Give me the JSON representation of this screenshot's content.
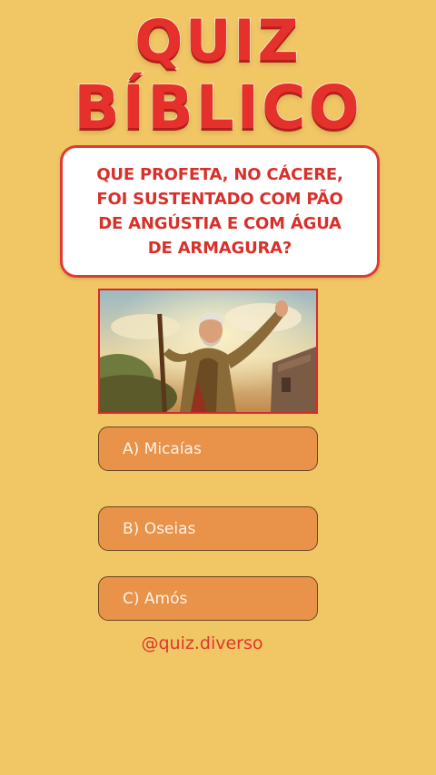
{
  "theme": {
    "background": "#f1c765",
    "accent": "#e5302b",
    "option_fill": "#e9924a"
  },
  "title": {
    "line1": "QUIZ",
    "line2": "BÍBLICO"
  },
  "question": {
    "line1": "QUE PROFETA, NO CÁCERE,",
    "line2": "FOI SUSTENTADO COM PÃO",
    "line3": "DE ANGÚSTIA E COM ÁGUA",
    "line4": "DE ARMAGURA?"
  },
  "illustration": {
    "icon": "prophet-with-staff-illustration"
  },
  "options": [
    {
      "label": "A) Micaías"
    },
    {
      "label": "B) Oseias"
    },
    {
      "label": "C) Amós"
    }
  ],
  "footer": {
    "handle": "@quiz.diverso"
  }
}
